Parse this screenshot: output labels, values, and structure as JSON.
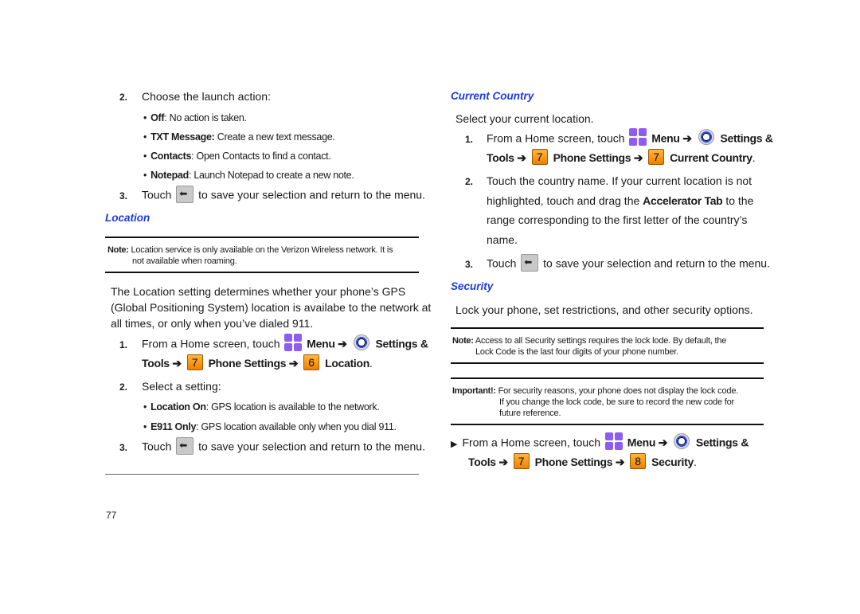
{
  "page_number": "77",
  "left": {
    "step2": {
      "num": "2.",
      "text": "Choose the launch action:"
    },
    "launch_options": [
      {
        "term": "Off",
        "sep": ": ",
        "desc": "No action is taken."
      },
      {
        "term": "TXT Message:",
        "sep": " ",
        "desc": "Create a new text message."
      },
      {
        "term": "Contacts",
        "sep": ": ",
        "desc": "Open Contacts to find a contact."
      },
      {
        "term": "Notepad",
        "sep": ": ",
        "desc": "Launch Notepad to create a new note."
      }
    ],
    "step3": {
      "num": "3.",
      "pre": "Touch",
      "post": "to save your selection and return to the menu."
    },
    "location_heading": "Location",
    "note": {
      "label": "Note:",
      "line1": "Location service is only available on the Verizon Wireless network. It is",
      "line2": "not available when roaming."
    },
    "intro": [
      "The Location setting determines whether your phone’s GPS",
      "(Global Positioning System) location is availabe to the network at",
      "all times, or only when you’ve dialed 911."
    ],
    "loc_step1": {
      "num": "1.",
      "pre": "From a Home screen, touch",
      "menu": "Menu ➔",
      "settings": "Settings &",
      "tools": "Tools ➔",
      "key1": "7",
      "phone_settings": "Phone Settings ➔",
      "key2": "6",
      "target": "Location",
      "end": "."
    },
    "loc_step2": {
      "num": "2.",
      "text": "Select a setting:"
    },
    "loc_options": [
      {
        "term": "Location On",
        "sep": ": ",
        "desc": "GPS location is available to the network."
      },
      {
        "term": "E911 Only",
        "sep": ": ",
        "desc": "GPS location available only when you dial 911."
      }
    ],
    "loc_step3": {
      "num": "3.",
      "pre": "Touch",
      "post": "to save your selection and return to the menu."
    }
  },
  "right": {
    "country_heading": "Current Country",
    "country_intro": "Select your current location.",
    "cc_step1": {
      "num": "1.",
      "pre": "From a Home screen, touch",
      "menu": "Menu ➔",
      "settings": "Settings &",
      "tools": "Tools ➔",
      "key1": "7",
      "phone_settings": "Phone Settings ➔",
      "key2": "7",
      "target": "Current Country",
      "end": "."
    },
    "cc_step2": {
      "num": "2.",
      "l1": "Touch the country name.  If your current location is not",
      "l2a": "highlighted, touch and drag the ",
      "l2b": "Accelerator Tab",
      "l2c": " to the",
      "l3": "range corresponding to the first letter of the country’s",
      "l4": "name."
    },
    "cc_step3": {
      "num": "3.",
      "pre": "Touch",
      "post": "to save your selection and return to the menu."
    },
    "security_heading": "Security",
    "security_intro": "Lock your phone, set restrictions, and other security options.",
    "note": {
      "label": "Note:",
      "line1": "Access to all Security settings requires the lock lode.  By default, the",
      "line2": "Lock Code is the last four digits of your phone number."
    },
    "important": {
      "label": "Important!:",
      "line1": "For security reasons, your phone does not display the lock code.",
      "line2": "If you change the lock code, be sure to record the new code for",
      "line3": "future reference."
    },
    "sec_step": {
      "pre": "From a Home screen, touch",
      "menu": "Menu ➔",
      "settings": "Settings &",
      "tools": "Tools ➔",
      "key1": "7",
      "phone_settings": "Phone Settings ➔",
      "key2": "8",
      "target": "Security",
      "end": "."
    }
  }
}
